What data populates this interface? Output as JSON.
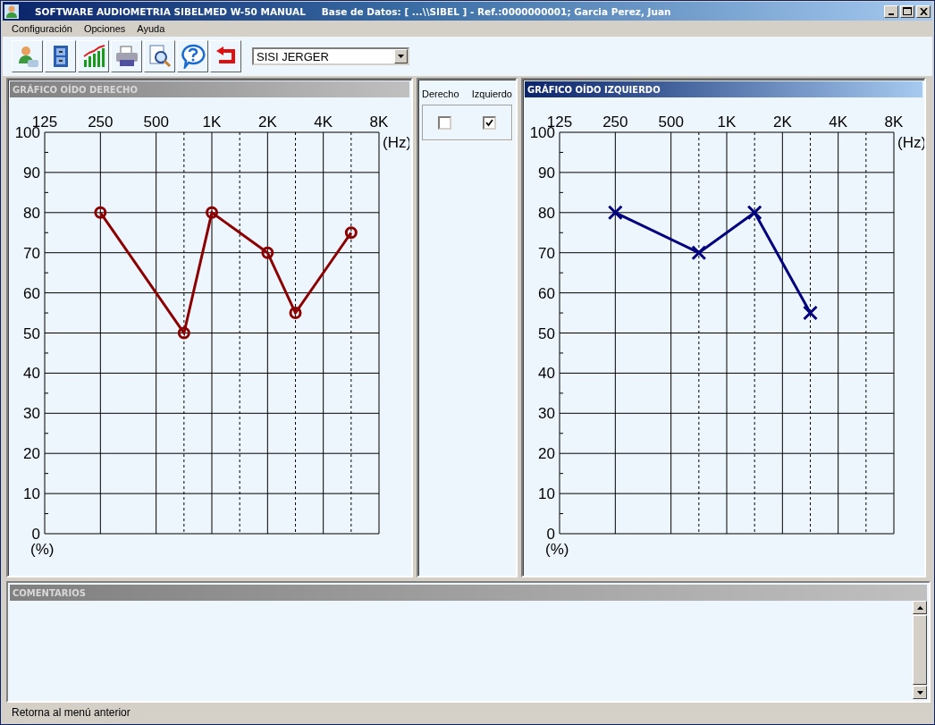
{
  "window": {
    "title": "SOFTWARE AUDIOMETRIA SIBELMED W-50  MANUAL",
    "subtitle": "Base de Datos:  [ ...\\\\SIBEL ] - Ref.:0000000001; Garcia Perez, Juan"
  },
  "menu": [
    "Configuración",
    "Opciones",
    "Ayuda"
  ],
  "toolbar": {
    "buttons": [
      {
        "kind": "patient"
      },
      {
        "kind": "cabinet"
      },
      {
        "kind": "chart"
      },
      {
        "kind": "printer"
      },
      {
        "kind": "preview"
      },
      {
        "kind": "help"
      },
      {
        "kind": "back"
      }
    ],
    "test_select": {
      "value": "SISI JERGER"
    }
  },
  "right_ear_panel": {
    "title": "GRÁFICO OÍDO DERECHO",
    "active": false,
    "chart_data": {
      "type": "line",
      "grid": true,
      "xlabel": "(Hz)",
      "ylabel": "(%)",
      "categories": [
        "125",
        null,
        "250",
        null,
        "500",
        null,
        "1K",
        null,
        "2K",
        null,
        "4K",
        null,
        "8K"
      ],
      "ylim": [
        0,
        100
      ],
      "yticks": [
        0,
        10,
        20,
        30,
        40,
        50,
        60,
        70,
        80,
        90,
        100
      ],
      "series": [
        {
          "marker": "circle",
          "color": "#8b0000",
          "values": [
            null,
            null,
            80,
            null,
            null,
            50,
            80,
            null,
            70,
            55,
            null,
            75,
            null
          ]
        }
      ]
    }
  },
  "ear_selector": {
    "options": [
      {
        "label": "Derecho",
        "checked": false
      },
      {
        "label": "Izquierdo",
        "checked": true
      }
    ]
  },
  "left_ear_panel": {
    "title": "GRÁFICO OÍDO IZQUIERDO",
    "active": true,
    "chart_data": {
      "type": "line",
      "grid": true,
      "xlabel": "(Hz)",
      "ylabel": "(%)",
      "categories": [
        "125",
        null,
        "250",
        null,
        "500",
        null,
        "1K",
        null,
        "2K",
        null,
        "4K",
        null,
        "8K"
      ],
      "ylim": [
        0,
        100
      ],
      "yticks": [
        0,
        10,
        20,
        30,
        40,
        50,
        60,
        70,
        80,
        90,
        100
      ],
      "series": [
        {
          "marker": "cross",
          "color": "#00007f",
          "values": [
            null,
            null,
            80,
            null,
            null,
            70,
            null,
            80,
            null,
            55,
            null,
            null,
            null
          ]
        }
      ]
    }
  },
  "comments": {
    "title": "COMENTARIOS"
  },
  "status_bar": "Retorna al menú anterior"
}
